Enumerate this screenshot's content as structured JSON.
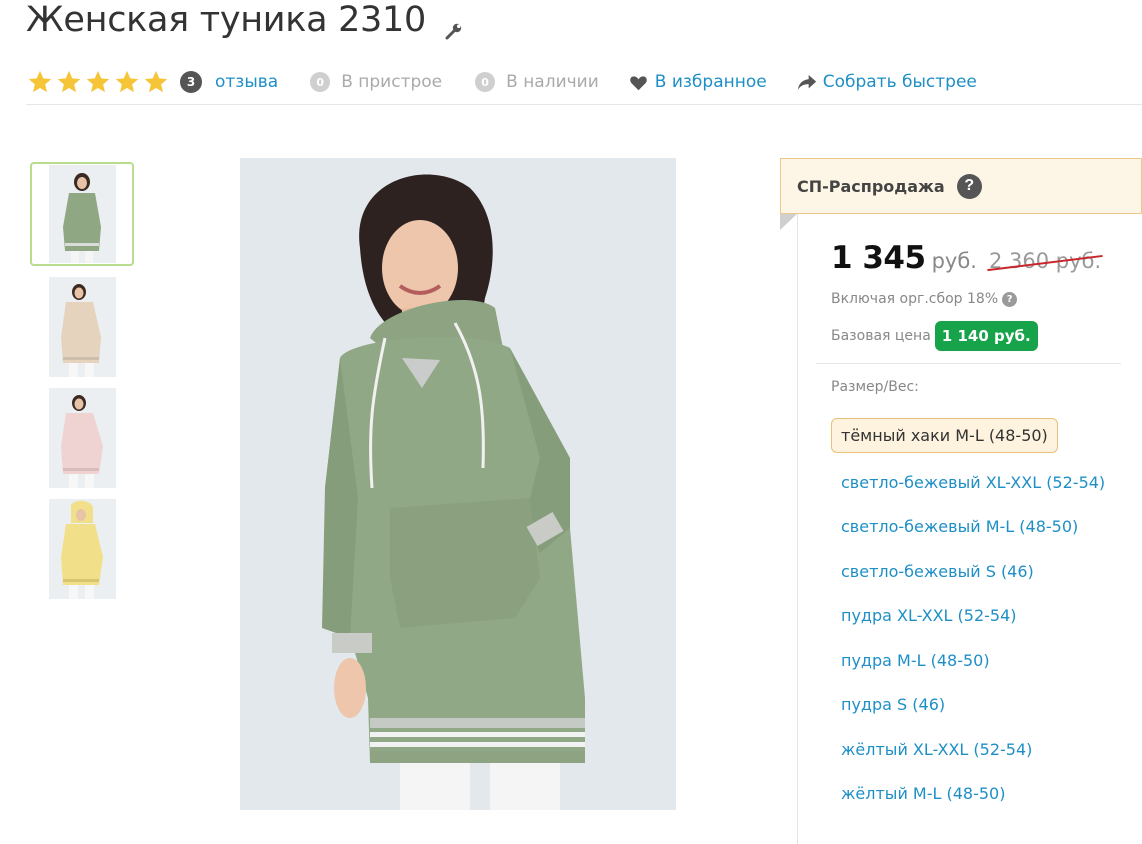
{
  "product": {
    "title": "Женская туника 2310",
    "rating_stars": 5,
    "reviews_count": "3",
    "reviews_label": "отзыва",
    "attach_count": "0",
    "attach_label": "В пристрое",
    "stock_count": "0",
    "stock_label": "В наличии",
    "favorite_label": "В избранное",
    "collect_label": "Собрать быстрее"
  },
  "promo": {
    "label": "СП-Распродажа",
    "help": "?"
  },
  "price": {
    "current": "1 345",
    "currency": "руб.",
    "old": "2 360 руб.",
    "includes": "Включая орг.сбор 18%",
    "includes_help": "?",
    "base_label": "Базовая цена",
    "base_value": "1 140 руб."
  },
  "sizes": {
    "label": "Размер/Вес:",
    "selected": "тёмный хаки M-L (48-50)",
    "options": [
      "светло-бежевый XL-XXL (52-54)",
      "светло-бежевый M-L (48-50)",
      "светло-бежевый S (46)",
      "пудра XL-XXL (52-54)",
      "пудра M-L (48-50)",
      "пудра S (46)",
      "жёлтый XL-XXL (52-54)",
      "жёлтый M-L (48-50)"
    ]
  },
  "colors": {
    "link": "#1e8fc6",
    "star": "#f6c437",
    "badge_green": "#17a34a",
    "khaki": "#8fa783",
    "beige": "#e6d3bd",
    "powder": "#efd3d3",
    "yellow": "#f1df8a"
  },
  "thumbnails": [
    {
      "name": "thumb-khaki",
      "color": "#8fa783"
    },
    {
      "name": "thumb-beige",
      "color": "#e6d3bd"
    },
    {
      "name": "thumb-powder",
      "color": "#efd3d3"
    },
    {
      "name": "thumb-yellow",
      "color": "#f1df8a"
    }
  ],
  "icons": {
    "edit": "wrench-icon",
    "star": "star-icon",
    "favorite": "heart-icon",
    "collect": "share-arrow-icon",
    "help": "question-icon"
  }
}
